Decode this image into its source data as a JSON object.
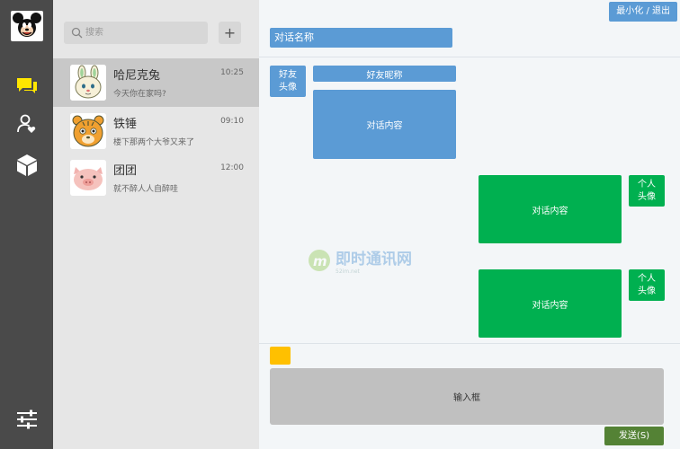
{
  "sidebar": {
    "icons": [
      "mickey-logo",
      "chat-icon",
      "contacts-icon",
      "cube-icon",
      "settings-sliders-icon"
    ],
    "active_color": "#ffe600"
  },
  "conversation_list": {
    "search_placeholder": "搜索",
    "add_label": "+",
    "items": [
      {
        "name": "哈尼克兔",
        "time": "10:25",
        "preview": "今天你在家吗?",
        "avatar_icon": "rabbit-avatar-icon"
      },
      {
        "name": "铁锤",
        "time": "09:10",
        "preview": "楼下那两个大爷又来了",
        "avatar_icon": "tiger-avatar-icon"
      },
      {
        "name": "团团",
        "time": "12:00",
        "preview": "就不醉人人自醉哇",
        "avatar_icon": "pig-avatar-icon"
      }
    ]
  },
  "chat": {
    "window_controls": "最小化 / 退出",
    "title": "对话名称",
    "friend_avatar": "好友\n头像",
    "friend_nickname": "好友昵称",
    "messages": [
      {
        "side": "left",
        "content": "对话内容"
      },
      {
        "side": "right",
        "content": "对话内容",
        "avatar": "个人\n头像"
      },
      {
        "side": "right",
        "content": "对话内容",
        "avatar": "个人\n头像"
      }
    ],
    "watermark_title": "即时通讯网",
    "watermark_sub": "52im.net",
    "input_placeholder": "输入框",
    "send_label": "发送(S)"
  },
  "colors": {
    "rail": "#4a4a4a",
    "list_bg": "#e6e6e6",
    "active_row": "#c8c8c8",
    "blue": "#5b9bd5",
    "green": "#00b050",
    "yellow": "#ffc000",
    "send": "#548235",
    "input": "#c0c0c0"
  }
}
